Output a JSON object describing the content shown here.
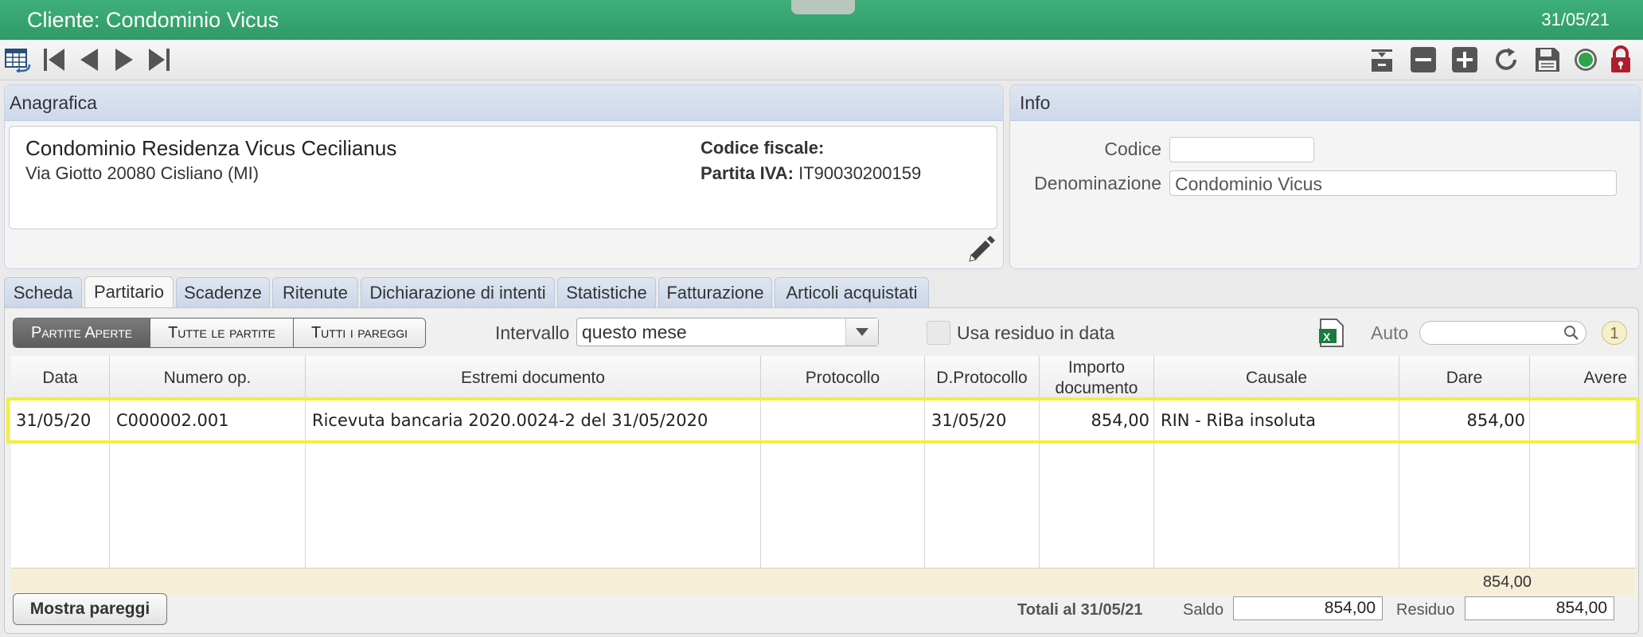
{
  "window": {
    "title": "Cliente: Condominio Vicus",
    "date": "31/05/21"
  },
  "toolbar": {
    "nav_icons": [
      "table-back-icon",
      "first-record-icon",
      "previous-record-icon",
      "next-record-icon",
      "last-record-icon"
    ],
    "action_icons": [
      "archive-icon",
      "minus-icon",
      "plus-icon",
      "refresh-icon",
      "save-icon",
      "status-green-icon",
      "lock-icon"
    ],
    "colors": {
      "green": "#2f9a65",
      "lock": "#b01e2e"
    }
  },
  "anagrafica": {
    "header": "Anagrafica",
    "name": "Condominio Residenza Vicus Cecilianus",
    "address": "Via Giotto 20080 Cisliano (MI)",
    "codice_fiscale_label": "Codice fiscale:",
    "partita_iva_label": "Partita IVA:",
    "partita_iva_value": "IT90030200159"
  },
  "info": {
    "header": "Info",
    "codice_label": "Codice",
    "codice_value": "",
    "denominazione_label": "Denominazione",
    "denominazione_value": "Condominio Vicus"
  },
  "tabs": [
    {
      "label": "Scheda"
    },
    {
      "label": "Partitario",
      "active": true
    },
    {
      "label": "Scadenze"
    },
    {
      "label": "Ritenute"
    },
    {
      "label": "Dichiarazione di intenti"
    },
    {
      "label": "Statistiche"
    },
    {
      "label": "Fatturazione"
    },
    {
      "label": "Articoli acquistati"
    }
  ],
  "filters": {
    "segments": [
      "Partite Aperte",
      "Tutte le partite",
      "Tutti i pareggi"
    ],
    "selected_segment": "Partite Aperte",
    "interval_label": "Intervallo",
    "interval_value": "questo mese",
    "residuo_label": "Usa residuo in data",
    "auto_label": "Auto",
    "search_value": "",
    "count_badge": "1"
  },
  "table": {
    "headers": [
      "Data",
      "Numero op.",
      "Estremi documento",
      "Protocollo",
      "D.Protocollo",
      "Importo documento",
      "Causale",
      "Dare",
      "Avere"
    ],
    "rows": [
      [
        "31/05/20",
        "C000002.001",
        "Ricevuta bancaria 2020.0024-2 del 31/05/2020",
        "",
        "31/05/20",
        "854,00",
        "RIN - RiBa insoluta",
        "854,00",
        ""
      ]
    ],
    "total_dare": "854,00"
  },
  "footer": {
    "mostra_button": "Mostra pareggi",
    "totali_label": "Totali al 31/05/21",
    "saldo_label": "Saldo",
    "saldo_value": "854,00",
    "residuo_label": "Residuo",
    "residuo_value": "854,00"
  }
}
